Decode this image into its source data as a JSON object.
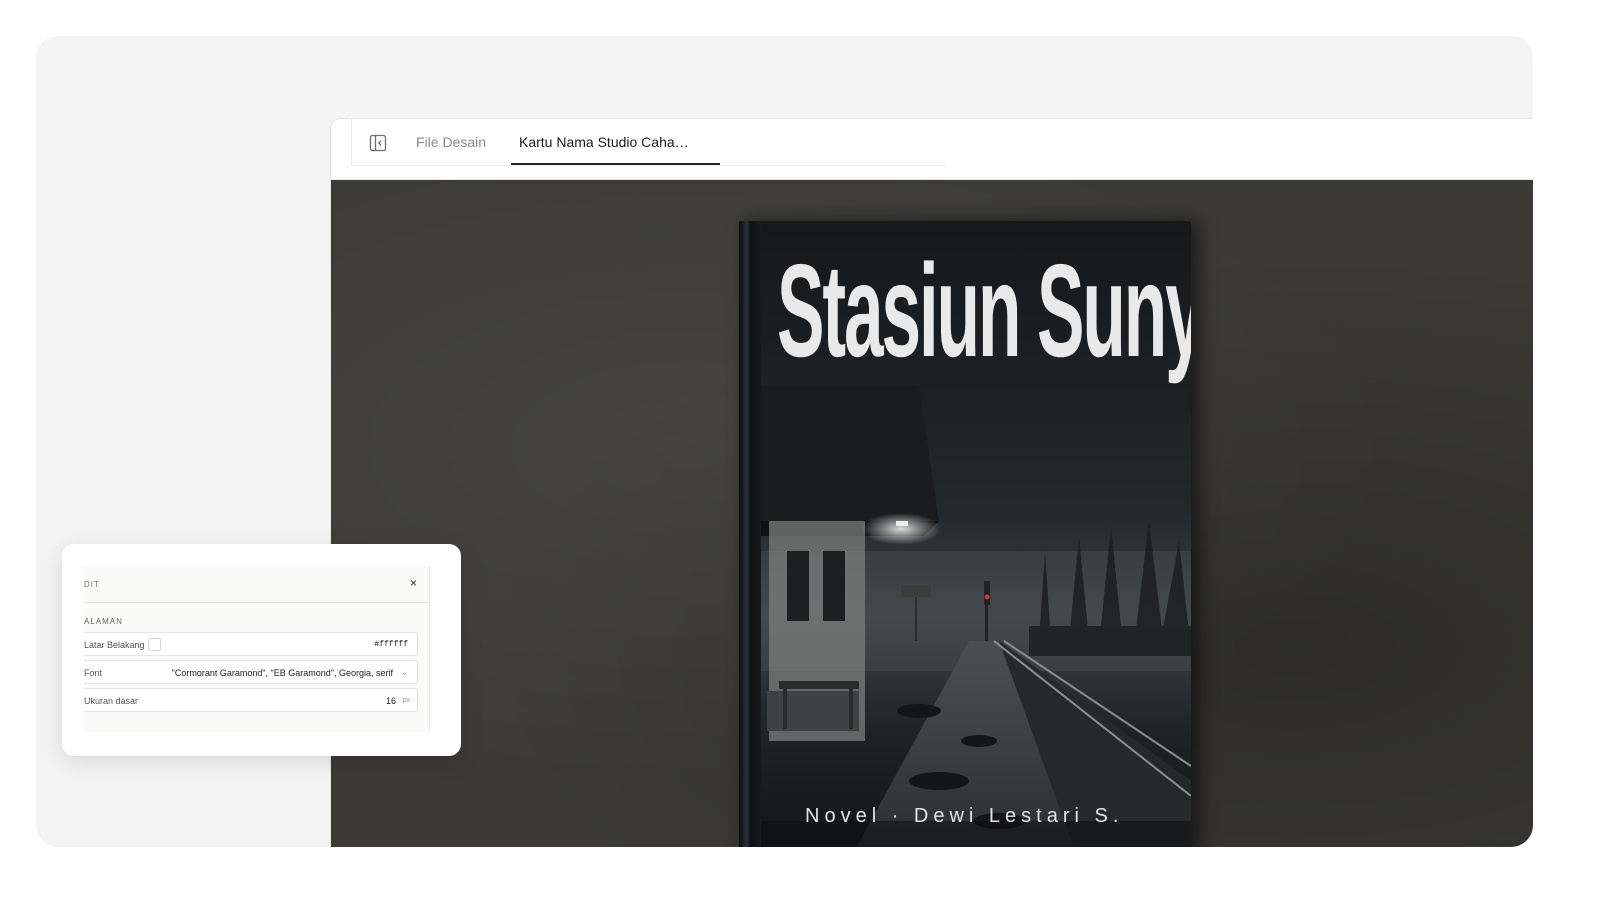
{
  "tabs": {
    "files_label": "File Desain",
    "active_label": "Kartu Nama Studio Caha…"
  },
  "book": {
    "title": "Stasiun Sunyi",
    "subtitle": "Novel · Dewi Lestari S."
  },
  "panel": {
    "title": "DIT",
    "close_glyph": "×",
    "section_label": "ALAMAN",
    "background": {
      "label": "Latar Belakang",
      "value": "#ffffff"
    },
    "font": {
      "label": "Font",
      "value": "\"Cormorant Garamond\", \"EB Garamond\", Georgia, serif",
      "chevron": "⌄"
    },
    "base_size": {
      "label": "Ukuran dasar",
      "value": "16",
      "unit": "px"
    }
  },
  "icons": {
    "sidebar_toggle": "sidebar-toggle-icon",
    "close": "close-icon",
    "chevron": "chevron-down-icon"
  }
}
